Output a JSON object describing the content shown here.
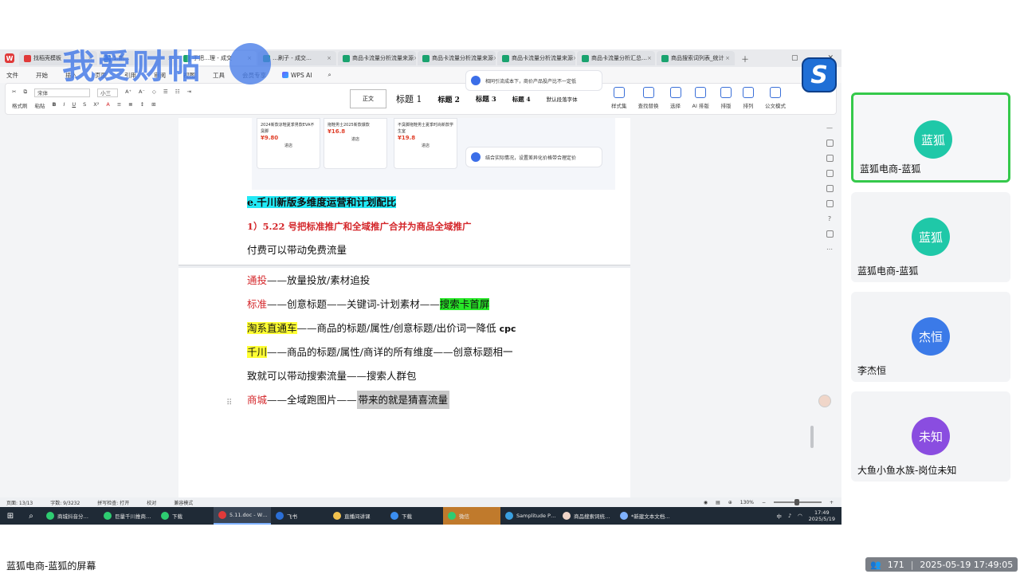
{
  "tabs": [
    {
      "label": "找稻壳模板",
      "icon": "red"
    },
    {
      "label": "1.新…",
      "icon": "blue"
    },
    {
      "label": "手把…理 - 成交",
      "icon": "green"
    },
    {
      "label": "…刷子 - 成交…",
      "icon": "green"
    },
    {
      "label": "商品卡流量分析流量来源",
      "icon": "green"
    },
    {
      "label": "商品卡流量分析流量来源",
      "icon": "green"
    },
    {
      "label": "商品卡流量分析流量来源",
      "icon": "green"
    },
    {
      "label": "商品卡流量分析汇总…",
      "icon": "green"
    },
    {
      "label": "商品搜索词列表_统计",
      "icon": "green"
    }
  ],
  "menu": [
    "文件",
    "开始",
    "插入",
    "页面",
    "引用",
    "审阅",
    "视图",
    "工具",
    "会员专享"
  ],
  "wps_ai": "WPS AI",
  "ribbon": {
    "font": "宋体",
    "size": "小三",
    "row1_left": [
      "格式刷",
      "粘贴"
    ],
    "styles": [
      "正文",
      "标题 1",
      "标题 2",
      "标题 3",
      "标题 4",
      "默认段落字体"
    ],
    "tools": [
      "样式集",
      "查找替换",
      "选择",
      "AI 排版",
      "排版",
      "排列",
      "公文模式"
    ]
  },
  "image_products": [
    {
      "title": "2024新款凉鞋夏季男款EVA不臭脚",
      "price": "¥9.80",
      "btn": "进店"
    },
    {
      "title": "拖鞋男士2025新款爆款",
      "price": "¥16.8",
      "btn": "进店"
    },
    {
      "title": "不臭脚拖鞋男士夏季时尚新款学生室",
      "price": "¥19.8",
      "btn": "进店"
    }
  ],
  "image_tips": [
    "相同引流成本下，商价产品投产比不一定低",
    "结合实际情况，设置差异化价格带合理定价"
  ],
  "doc": {
    "heading": "e.千川新版多维度运营和计划配比",
    "item1": "1）5.22 号把标准推广和全域推广合并为商品全域推广",
    "line_paid": "付费可以带动免费流量",
    "l1_a": "通投",
    "l1_b": "——放量投放/素材追投",
    "l2_a": "标准",
    "l2_b": "——创意标题——关键词-计划素材——",
    "l2_c": "搜索卡首屏",
    "l3_a": "淘系直通车",
    "l3_b": "——商品的标题/属性/创意标题/出价词一降低 ",
    "l3_c": "cpc",
    "l4_a": "千川",
    "l4_b": "——商品的标题/属性/商详的所有维度——创意标题相一",
    "l5": "致就可以带动搜索流量——搜索人群包",
    "l6_a": "商城",
    "l6_b": "——全域跑图片——",
    "l6_c": "带来的就是猜喜流量"
  },
  "statusbar": {
    "page": "页面: 13/13",
    "words": "字数: 9/3232",
    "spell": "拼写检查: 打开",
    "proof": "校对",
    "compat": "兼容模式",
    "zoom": "130%"
  },
  "taskbar": [
    {
      "label": "商城抖音分…",
      "state": ""
    },
    {
      "label": "巨量千川推商…",
      "state": ""
    },
    {
      "label": "下载",
      "state": ""
    },
    {
      "label": "5.11.doc - W…",
      "state": "active"
    },
    {
      "label": "飞书",
      "state": ""
    },
    {
      "label": "直播间讲课",
      "state": ""
    },
    {
      "label": "下载",
      "state": ""
    },
    {
      "label": "微信",
      "state": "hl"
    },
    {
      "label": "Samplitude P…",
      "state": ""
    },
    {
      "label": "商品搜索词统…",
      "state": ""
    },
    {
      "label": "*新建文本文档…",
      "state": ""
    }
  ],
  "clock": {
    "time": "17:49",
    "date": "2025/5/19"
  },
  "watermark": "我爱财帖",
  "participants": [
    {
      "avatar": "蓝狐",
      "name": "蓝狐电商-蓝狐",
      "color": "#1fc8a8",
      "active": true
    },
    {
      "avatar": "蓝狐",
      "name": "蓝狐电商-蓝狐",
      "color": "#1fc8a8",
      "active": false
    },
    {
      "avatar": "杰恒",
      "name": "李杰恒",
      "color": "#3b7ae8",
      "active": false
    },
    {
      "avatar": "未知",
      "name": "大鱼小鱼水族-岗位未知",
      "color": "#8a4de0",
      "active": false
    }
  ],
  "share_label": "蓝狐电商-蓝狐的屏幕",
  "viewer_count": "171",
  "timestamp": "2025-05-19 17:49:05"
}
